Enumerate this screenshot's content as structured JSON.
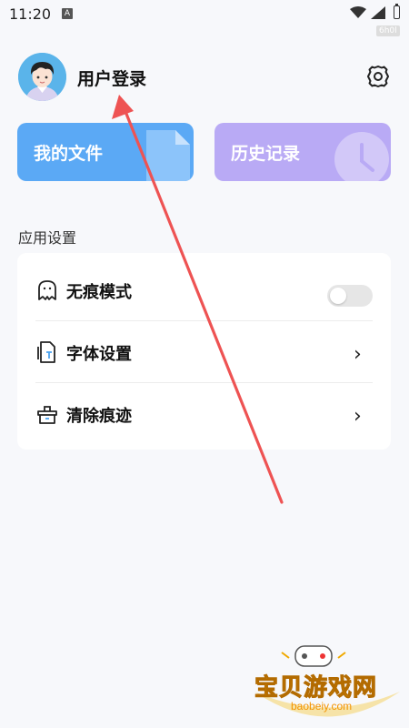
{
  "status_bar": {
    "time": "11:20",
    "notification_icon": "A",
    "tag": "6h0l"
  },
  "header": {
    "login_label": "用户登录"
  },
  "cards": [
    {
      "label": "我的文件",
      "color": "#5ba9f5",
      "icon": "file-icon"
    },
    {
      "label": "历史记录",
      "color": "#b9aaf5",
      "icon": "clock-icon"
    }
  ],
  "section": {
    "title": "应用设置"
  },
  "settings": [
    {
      "label": "无痕模式",
      "icon": "ghost-icon",
      "control": "toggle",
      "on": false
    },
    {
      "label": "字体设置",
      "icon": "font-file-icon",
      "control": "chevron"
    },
    {
      "label": "清除痕迹",
      "icon": "broom-icon",
      "control": "chevron"
    }
  ],
  "watermark": {
    "text": "宝贝游戏网",
    "url": "baobeiy.com"
  }
}
